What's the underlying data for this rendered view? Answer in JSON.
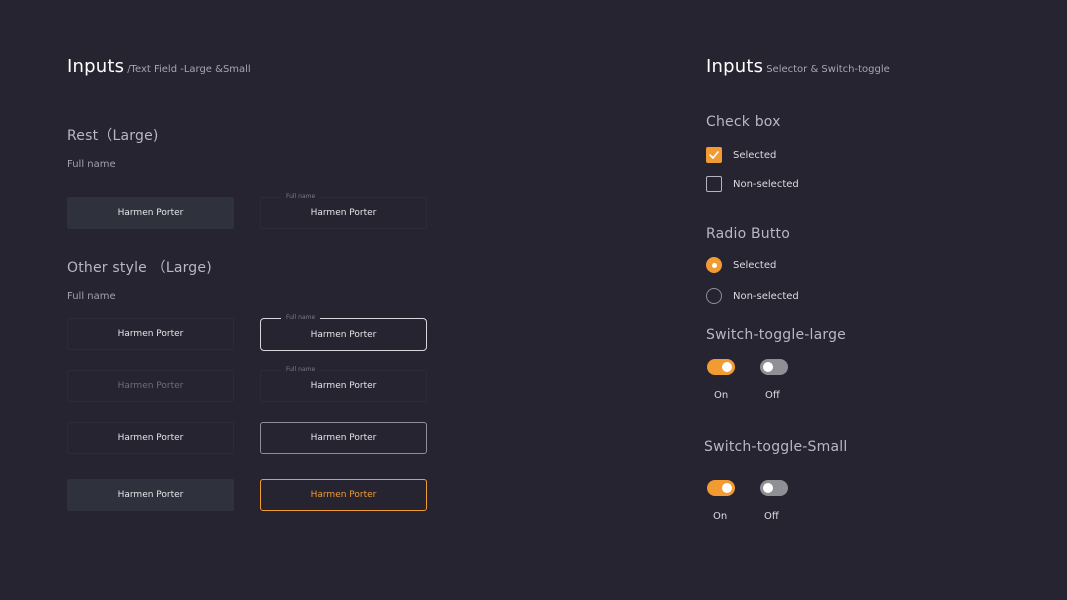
{
  "left": {
    "title": "Inputs",
    "subtitle": "/Text Field -Large &Small",
    "rest_heading": "Rest（Large)",
    "field_label": "Full name",
    "other_heading": "Other style （Large)",
    "field_value": "Harmen Porter",
    "floating_label": "Full name"
  },
  "right": {
    "title": "Inputs",
    "subtitle": "Selector & Switch-toggle",
    "checkbox_heading": "Check box",
    "radio_heading": "Radio Butto",
    "selected": "Selected",
    "non_selected": "Non-selected",
    "switch_large_heading": "Switch-toggle-large",
    "switch_small_heading": "Switch-toggle-Small",
    "on": "On",
    "off": "Off"
  },
  "colors": {
    "background": "#252430",
    "accent": "#f39b33",
    "field_fill": "#2f313c"
  }
}
